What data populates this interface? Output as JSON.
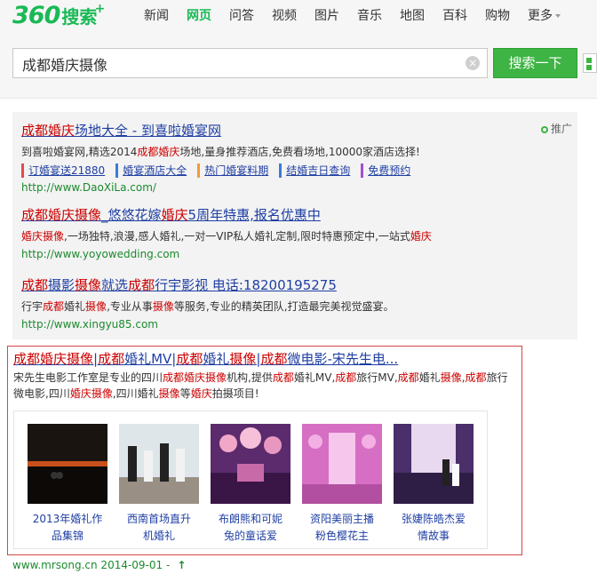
{
  "logo": {
    "num": "360",
    "cn": "搜索",
    "plus": "+"
  },
  "nav": {
    "items": [
      "新闻",
      "网页",
      "问答",
      "视频",
      "图片",
      "音乐",
      "地图",
      "百科",
      "购物",
      "更多"
    ],
    "active": "网页"
  },
  "search": {
    "query": "成都婚庆摄像",
    "button": "搜索一下"
  },
  "ads": {
    "tag": "推广",
    "results": [
      {
        "title": "成都婚庆场地大全 - 到喜啦婚宴网",
        "desc": "到喜啦婚宴网,精选2014成都婚庆场地,量身推荐酒店,免费看场地,10000家酒店选择!",
        "links": [
          "订婚宴送21880",
          "婚宴酒店大全",
          "热门婚宴料期",
          "结婚吉日查询",
          "免费预约"
        ],
        "url": "http://www.DaoXiLa.com/"
      },
      {
        "title": "成都婚庆摄像_悠悠花嫁婚庆5周年特惠,报名优惠中",
        "desc": "婚庆摄像,一场独特,浪漫,感人婚礼,一对一VIP私人婚礼定制,限时特惠预定中,一站式婚庆",
        "url": "http://www.yoyowedding.com"
      },
      {
        "title": "成都摄影摄像就选成都行宇影视 电话:18200195275",
        "desc": "行宇成都婚礼摄像,专业从事摄像等服务,专业的精英团队,打造最完美视觉盛宴。",
        "url": "http://www.xingyu85.com"
      }
    ]
  },
  "card": {
    "title": "成都婚庆摄像|成都婚礼MV|成都婚礼摄像|成都微电影-宋先生电...",
    "desc": "宋先生电影工作室是专业的四川成都婚庆摄像机构,提供成都婚礼MV,成都旅行MV,成都婚礼摄像,成都旅行微电影,四川婚庆摄像,四川婚礼摄像等婚庆拍摄项目!",
    "gallery": [
      {
        "line1": "2013年婚礼作",
        "line2": "品集锦"
      },
      {
        "line1": "西南首场直升",
        "line2": "机婚礼"
      },
      {
        "line1": "布朗熊和可妮",
        "line2": "兔的童话爱"
      },
      {
        "line1": "资阳美丽主播",
        "line2": "粉色樱花主"
      },
      {
        "line1": "张婕陈皓杰爱",
        "line2": "情故事"
      }
    ],
    "url": "www.mrsong.cn 2014-09-01 -"
  },
  "colors": {
    "brand": "#19b955",
    "link": "#1f3fa3",
    "highlight": "#cc0000",
    "url": "#1b8a2d",
    "card_border": "#d34848"
  }
}
